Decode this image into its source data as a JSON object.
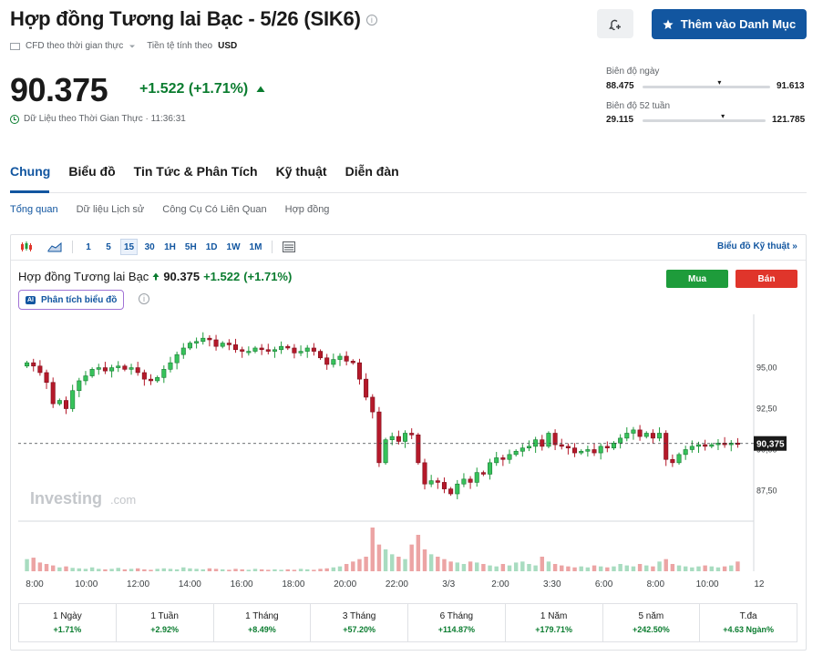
{
  "header": {
    "title": "Hợp đồng Tương lai Bạc - 5/26 (SIK6)",
    "info_glyph": "i",
    "watchlist_label": "Thêm vào Danh Mục",
    "cfd_label": "CFD theo thời gian thực",
    "currency_label": "Tiền tệ tính theo",
    "currency": "USD"
  },
  "quote": {
    "price": "90.375",
    "change": "+1.522 (+1.71%)",
    "realtime_label": "Dữ Liệu theo Thời Gian Thực · 11:36:31"
  },
  "ranges": {
    "day": {
      "label": "Biên độ ngày",
      "low": "88.475",
      "high": "91.613",
      "position": 0.61
    },
    "week52": {
      "label": "Biên độ 52 tuần",
      "low": "29.115",
      "high": "121.785",
      "position": 0.66
    }
  },
  "tabs": [
    {
      "label": "Chung",
      "active": true
    },
    {
      "label": "Biểu đồ",
      "active": false
    },
    {
      "label": "Tin Tức & Phân Tích",
      "active": false
    },
    {
      "label": "Kỹ thuật",
      "active": false
    },
    {
      "label": "Diễn đàn",
      "active": false
    }
  ],
  "subtabs": [
    {
      "label": "Tổng quan",
      "active": true
    },
    {
      "label": "Dữ liệu Lịch sử",
      "active": false
    },
    {
      "label": "Công Cụ Có Liên Quan",
      "active": false
    },
    {
      "label": "Hợp đồng",
      "active": false
    }
  ],
  "toolbar": {
    "intervals": [
      "1",
      "5",
      "15",
      "30",
      "1H",
      "5H",
      "1D",
      "1W",
      "1M"
    ],
    "selected_interval": "15",
    "chart_link": "Biểu đồ Kỹ thuật »"
  },
  "chart_header": {
    "name": "Hợp đồng Tương lai Bạc",
    "price": "90.375",
    "change": "+1.522",
    "change_pct": "(+1.71%)",
    "buy_label": "Mua",
    "sell_label": "Bán",
    "ai_badge": "AI",
    "ai_label": "Phân tích biểu đồ",
    "watermark": "Investing",
    "watermark_suffix": ".com"
  },
  "colors": {
    "up": "#1e9c3b",
    "down": "#b5192a",
    "vol_up": "#a8dcc0",
    "vol_down": "#eca4a4",
    "brand": "#1256a0"
  },
  "chart_data": {
    "type": "candlestick",
    "y_ticks": [
      "95,00",
      "92,50",
      "90,00",
      "87,50"
    ],
    "y_tick_values": [
      95,
      92.5,
      90,
      87.5
    ],
    "ylim": [
      86.3,
      97.7
    ],
    "last_price_label": "90,375",
    "last_price": 90.375,
    "x_tick_labels": [
      "8:00",
      "10:00",
      "12:00",
      "14:00",
      "16:00",
      "18:00",
      "20:00",
      "22:00",
      "3/3",
      "2:00",
      "3:30",
      "6:00",
      "8:00",
      "10:00",
      "12"
    ],
    "closes": [
      95.3,
      95.1,
      94.7,
      94.1,
      92.8,
      93.0,
      92.5,
      93.6,
      94.2,
      94.5,
      94.9,
      95.0,
      94.8,
      95.0,
      95.1,
      94.9,
      95.0,
      94.7,
      94.3,
      94.2,
      94.4,
      94.9,
      95.3,
      95.8,
      96.2,
      96.5,
      96.6,
      96.8,
      96.7,
      96.3,
      96.5,
      96.4,
      96.1,
      96.0,
      96.0,
      96.2,
      96.1,
      96.0,
      96.1,
      96.3,
      96.2,
      95.9,
      96.0,
      96.2,
      96.0,
      95.6,
      95.2,
      95.5,
      95.7,
      95.4,
      95.3,
      94.3,
      93.2,
      92.3,
      89.2,
      90.6,
      90.8,
      90.5,
      91.0,
      90.9,
      89.2,
      87.9,
      88.1,
      88.0,
      87.6,
      87.3,
      87.9,
      88.2,
      88.0,
      88.6,
      88.5,
      89.2,
      89.5,
      89.4,
      89.7,
      89.9,
      90.1,
      90.2,
      90.6,
      90.2,
      91.0,
      90.3,
      90.2,
      90.1,
      89.8,
      89.9,
      90.0,
      89.8,
      90.2,
      90.1,
      90.4,
      90.7,
      91.0,
      91.2,
      90.8,
      91.0,
      90.7,
      91.0,
      89.4,
      89.2,
      89.7,
      90.0,
      90.2,
      90.3,
      90.2,
      90.3,
      90.4,
      90.3,
      90.4,
      90.375
    ],
    "volumes": [
      0.25,
      0.28,
      0.18,
      0.15,
      0.12,
      0.08,
      0.1,
      0.07,
      0.06,
      0.05,
      0.08,
      0.05,
      0.04,
      0.05,
      0.07,
      0.04,
      0.05,
      0.06,
      0.04,
      0.03,
      0.05,
      0.06,
      0.05,
      0.04,
      0.08,
      0.06,
      0.05,
      0.04,
      0.06,
      0.05,
      0.04,
      0.03,
      0.05,
      0.04,
      0.03,
      0.05,
      0.04,
      0.03,
      0.04,
      0.03,
      0.04,
      0.03,
      0.05,
      0.04,
      0.03,
      0.05,
      0.06,
      0.08,
      0.1,
      0.15,
      0.2,
      0.25,
      0.3,
      0.9,
      0.55,
      0.45,
      0.35,
      0.3,
      0.25,
      0.55,
      0.75,
      0.45,
      0.35,
      0.3,
      0.25,
      0.2,
      0.18,
      0.15,
      0.2,
      0.18,
      0.15,
      0.12,
      0.1,
      0.15,
      0.12,
      0.18,
      0.2,
      0.15,
      0.12,
      0.3,
      0.2,
      0.15,
      0.12,
      0.1,
      0.08,
      0.1,
      0.08,
      0.12,
      0.1,
      0.08,
      0.1,
      0.15,
      0.12,
      0.1,
      0.15,
      0.12,
      0.1,
      0.2,
      0.25,
      0.15,
      0.12,
      0.1,
      0.08,
      0.1,
      0.12,
      0.1,
      0.08,
      0.1,
      0.12,
      0.2
    ]
  },
  "performance": [
    {
      "label": "1 Ngày",
      "value": "+1.71%"
    },
    {
      "label": "1 Tuần",
      "value": "+2.92%"
    },
    {
      "label": "1 Tháng",
      "value": "+8.49%"
    },
    {
      "label": "3 Tháng",
      "value": "+57.20%"
    },
    {
      "label": "6 Tháng",
      "value": "+114.87%"
    },
    {
      "label": "1 Năm",
      "value": "+179.71%"
    },
    {
      "label": "5 năm",
      "value": "+242.50%"
    },
    {
      "label": "T.đa",
      "value": "+4.63 Ngàn%"
    }
  ]
}
